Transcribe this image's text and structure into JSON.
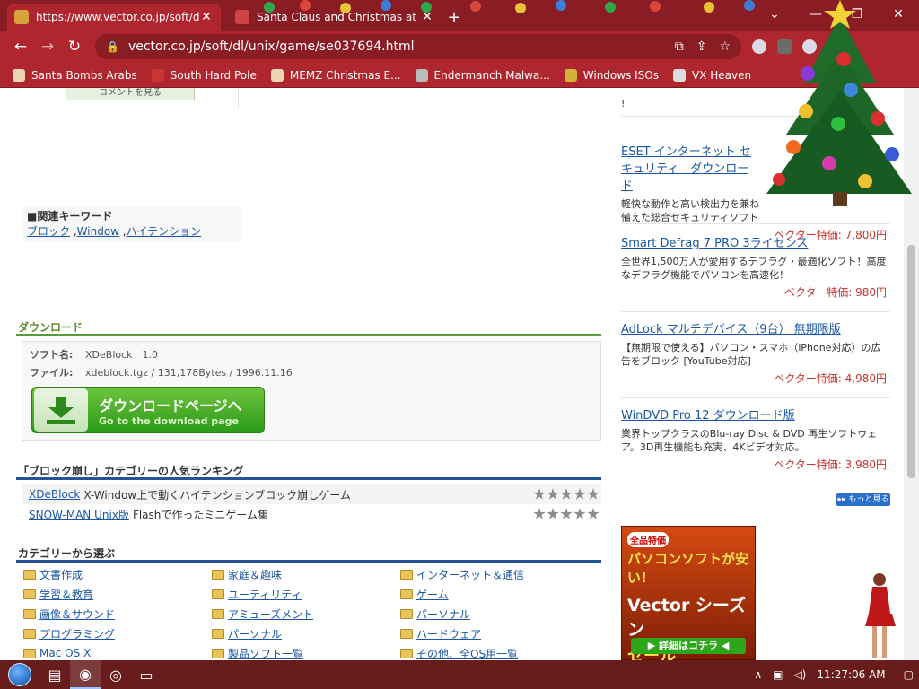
{
  "browser": {
    "tabs": [
      {
        "title": "https://www.vector.co.jp/soft/dl/",
        "active": true
      },
      {
        "title": "Santa Claus and Christmas at the",
        "active": false
      }
    ],
    "new_tab_symbol": "+",
    "url": "vector.co.jp/soft/dl/unix/game/se037694.html",
    "bookmarks": [
      "Santa Bombs Arabs",
      "South Hard Pole",
      "MEMZ Christmas E...",
      "Endermanch Malwa...",
      "Windows ISOs",
      "VX Heaven"
    ]
  },
  "page": {
    "comment_button": "コメントを見る",
    "keywords": {
      "heading": "■関連キーワード",
      "items": [
        "ブロック",
        "Window",
        "ハイテンション"
      ]
    },
    "download": {
      "section_title": "ダウンロード",
      "soft_label": "ソフト名:",
      "soft_value": "XDeBlock　1.0",
      "file_label": "ファイル:",
      "file_value": "xdeblock.tgz / 131,178Bytes / 1996.11.16",
      "button_jp": "ダウンロードページへ",
      "button_en": "Go to the download page"
    },
    "ranking": {
      "title": "「ブロック崩し」カテゴリーの人気ランキング",
      "items": [
        {
          "name": "XDeBlock",
          "desc": "X-Window上で動くハイテンションブロック崩しゲーム",
          "stars": 5
        },
        {
          "name": "SNOW-MAN Unix版",
          "desc": "Flashで作ったミニゲーム集",
          "stars": 5
        }
      ]
    },
    "categories": {
      "title": "カテゴリーから選ぶ",
      "items": [
        "文書作成",
        "家庭＆趣味",
        "インターネット＆通信",
        "学習＆教育",
        "ユーティリティ",
        "ゲーム",
        "画像＆サウンド",
        "アミューズメント",
        "パーソナル",
        "プログラミング",
        "パーソナル",
        "ハードウェア",
        "Mac OS X",
        "製品ソフト一覧",
        "その他、全OS用一覧"
      ]
    },
    "ads": [
      {
        "title": "ESET インターネット セキュリティ　ダウンロード",
        "desc": "軽快な動作と高い検出力を兼ね備えた総合セキュリティソフト",
        "price": "ベクター特価: 7,800円"
      },
      {
        "title": "Smart Defrag 7 PRO 3ライセンス",
        "desc": "全世界1,500万人が愛用するデフラグ・最適化ソフト！高度なデフラグ機能でパソコンを高速化！",
        "price": "ベクター特価: 980円"
      },
      {
        "title": "AdLock マルチデバイス（9台） 無期限版",
        "desc": "【無期限で使える】パソコン・スマホ（iPhone対応）の広告をブロック [YouTube対応]",
        "price": "ベクター特価: 4,980円"
      },
      {
        "title": "WinDVD Pro 12 ダウンロード版",
        "desc": "業界トップクラスのBlu-ray Disc & DVD 再生ソフトウェア。3D再生機能も充実、4Kビデオ対応。",
        "price": "ベクター特価: 3,980円"
      }
    ],
    "ads_partial_top": "!",
    "more_label": "もっと見る",
    "banner": {
      "badge": "全品特価",
      "line1": "パソコンソフトが安い!",
      "line2": "Vector シーズン",
      "line3": "セール AUTUMN",
      "cta": "▶ 詳細はコチラ ◀"
    }
  },
  "taskbar": {
    "time": "11:27:06 AM"
  }
}
